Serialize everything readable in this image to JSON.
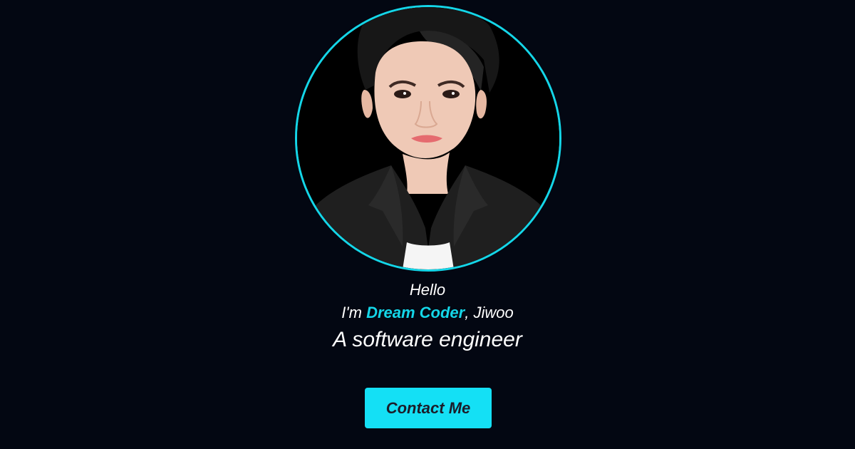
{
  "hero": {
    "greeting": "Hello",
    "intro_prefix": "I'm ",
    "brand_name": "Dream Coder",
    "intro_suffix": ", Jiwoo",
    "role": "A software engineer",
    "contact_button": "Contact Me"
  },
  "avatar": {
    "ring_color": "#14d6e8",
    "icon": "profile-photo"
  },
  "colors": {
    "background": "#030712",
    "accent": "#14e0f5",
    "button_text": "#1b1d2a",
    "text": "#ffffff"
  }
}
